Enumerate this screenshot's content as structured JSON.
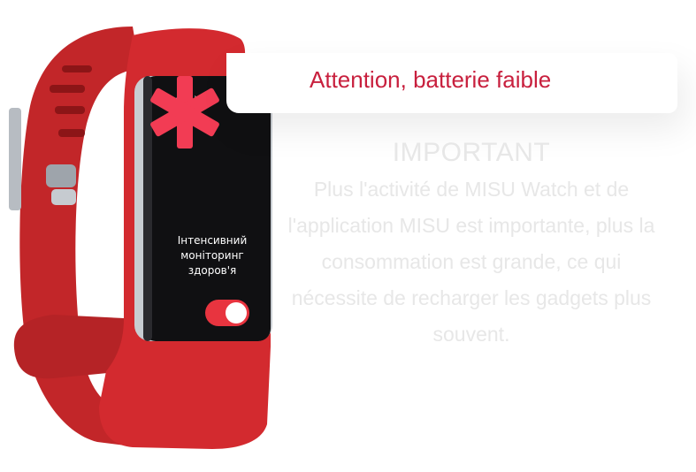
{
  "banner": {
    "text": "Attention, batterie faible"
  },
  "device": {
    "status_icon": "nfc-signal-icon",
    "screen_icon": "medical-asterisk-icon",
    "screen_label": "Інтенсивний моніторинг здоров'я",
    "toggle_state": "on",
    "strap_color": "#d32a2f",
    "accent_color": "#f23c54"
  },
  "info": {
    "title": "IMPORTANT",
    "body": "Plus l'activité de MISU Watch et de l'application MISU est importante, plus la consommation est grande, ce qui nécessite de recharger les gadgets plus souvent."
  }
}
